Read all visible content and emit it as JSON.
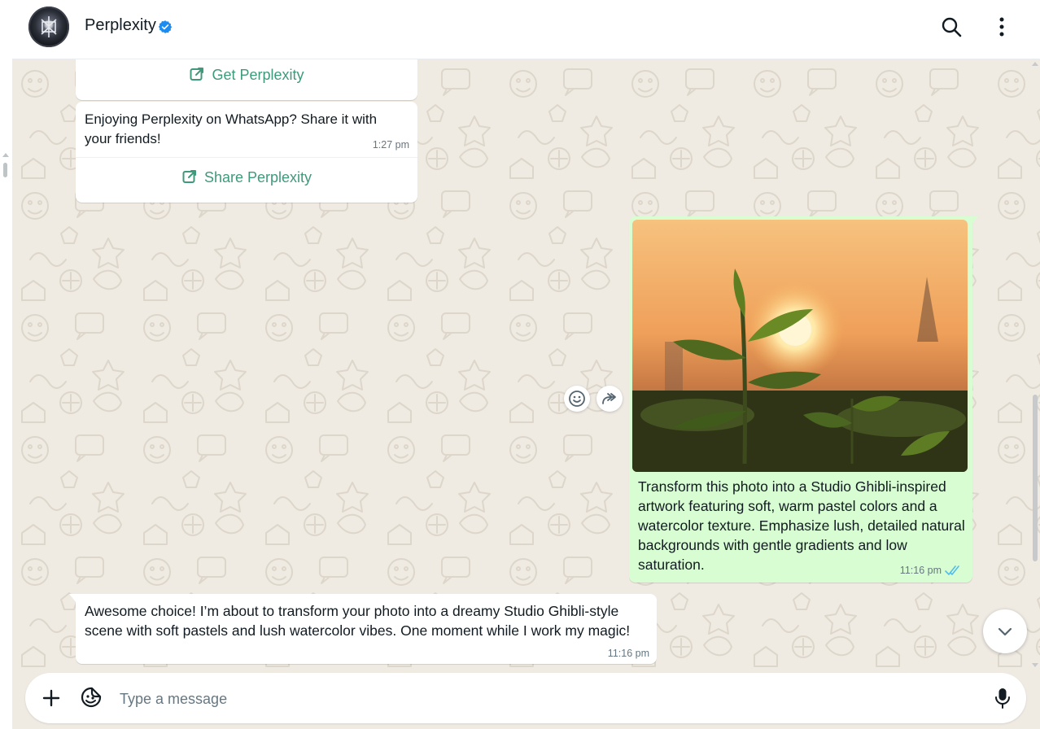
{
  "contact": {
    "name": "Perplexity",
    "verified": true
  },
  "header": {
    "icons": [
      "search-icon",
      "menu-icon"
    ]
  },
  "messages": {
    "get_card": {
      "link_label": "Get Perplexity",
      "icon": "external-link-icon"
    },
    "share_card": {
      "text": "Enjoying Perplexity on WhatsApp? Share it with your friends!",
      "time": "1:27 pm",
      "link_label": "Share Perplexity",
      "icon": "external-link-icon"
    },
    "image_message": {
      "image": "sunset-tea-plant-photo",
      "caption": "Transform this photo into a Studio Ghibli-inspired artwork featuring soft, warm pastel colors and a watercolor texture. Emphasize lush, detailed natural backgrounds with gentle gradients and low saturation.",
      "time": "11:16 pm",
      "status": "read"
    },
    "reply": {
      "text": "Awesome choice! I’m about to transform your photo into a dreamy Studio Ghibli-style scene with soft pastels and lush watercolor vibes. One moment while I work my magic!",
      "time": "11:16 pm"
    }
  },
  "composer": {
    "placeholder": "Type a message",
    "icons": [
      "plus-icon",
      "sticker-icon",
      "microphone-icon"
    ]
  },
  "colors": {
    "chat_background": "#efeae2",
    "outgoing_bubble": "#d9fdd3",
    "incoming_bubble": "#ffffff",
    "link_green": "#3f9a7b",
    "verified_blue": "#1d8cf0",
    "read_ticks": "#53bdeb"
  }
}
